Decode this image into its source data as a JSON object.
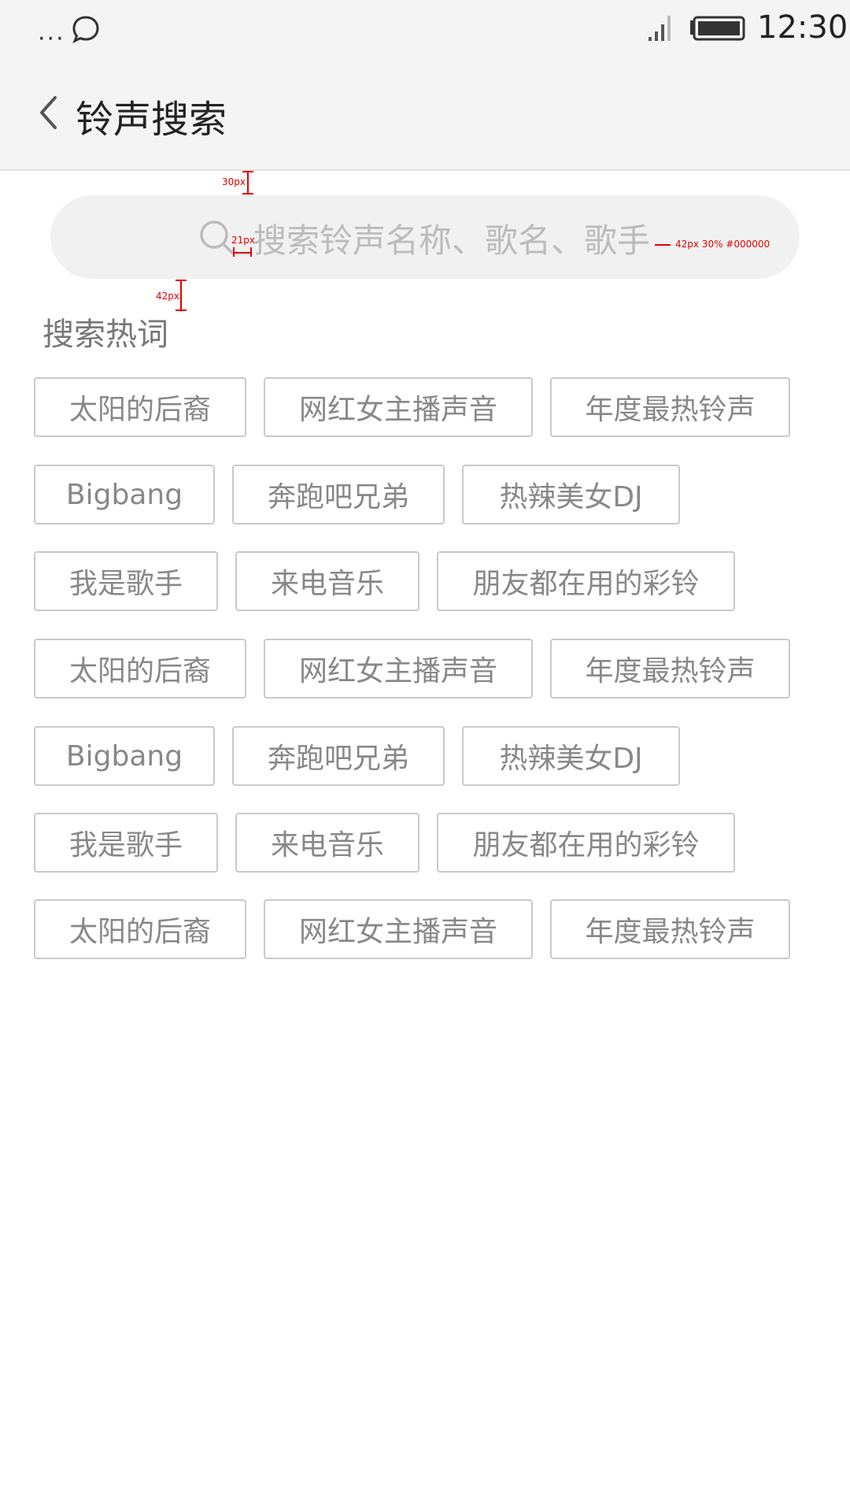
{
  "status_bar": {
    "time": "12:30",
    "dots": "···"
  },
  "header": {
    "title": "铃声搜索"
  },
  "search": {
    "placeholder": "搜索铃声名称、歌名、歌手"
  },
  "annotations": {
    "top_gap": "30px",
    "icon_gap": "21px",
    "text_spec": "42px 30% #000000",
    "title_gap": "42px"
  },
  "hot": {
    "title": "搜索热词",
    "rows": [
      [
        "太阳的后裔",
        "网红女主播声音",
        "年度最热铃声"
      ],
      [
        "Bigbang",
        "奔跑吧兄弟",
        "热辣美女DJ"
      ],
      [
        "我是歌手",
        "来电音乐",
        "朋友都在用的彩铃"
      ],
      [
        "太阳的后裔",
        "网红女主播声音",
        "年度最热铃声"
      ],
      [
        "Bigbang",
        "奔跑吧兄弟",
        "热辣美女DJ"
      ],
      [
        "我是歌手",
        "来电音乐",
        "朋友都在用的彩铃"
      ],
      [
        "太阳的后裔",
        "网红女主播声音",
        "年度最热铃声"
      ]
    ]
  },
  "colors": {
    "annotation": "#e00000",
    "tag_border": "#c9c9c9",
    "tag_text": "#888888"
  }
}
